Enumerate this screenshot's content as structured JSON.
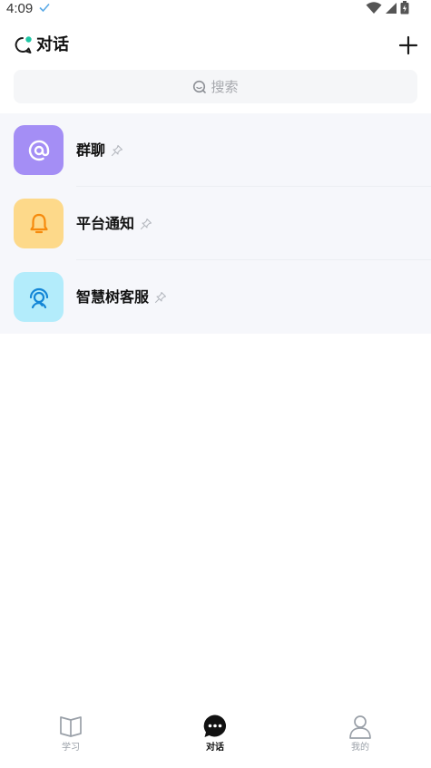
{
  "status_bar": {
    "time": "4:09"
  },
  "header": {
    "title": "对话"
  },
  "search": {
    "placeholder": "搜索"
  },
  "conversations": [
    {
      "name": "群聊",
      "avatar_color": "#a48ef5",
      "icon": "at-chat-icon"
    },
    {
      "name": "平台通知",
      "avatar_color": "#fdd98a",
      "icon": "bell-icon"
    },
    {
      "name": "智慧树客服",
      "avatar_color": "#b3ecfb",
      "icon": "support-agent-icon"
    }
  ],
  "tabbar": {
    "tabs": [
      {
        "label": "学习",
        "icon": "book-icon",
        "active": false
      },
      {
        "label": "对话",
        "icon": "chat-bubble-icon",
        "active": true
      },
      {
        "label": "我的",
        "icon": "person-icon",
        "active": false
      }
    ]
  },
  "colors": {
    "accent_green": "#1fc7a5",
    "active_tab": "#111111",
    "inactive_tab": "#9aa0a8"
  }
}
